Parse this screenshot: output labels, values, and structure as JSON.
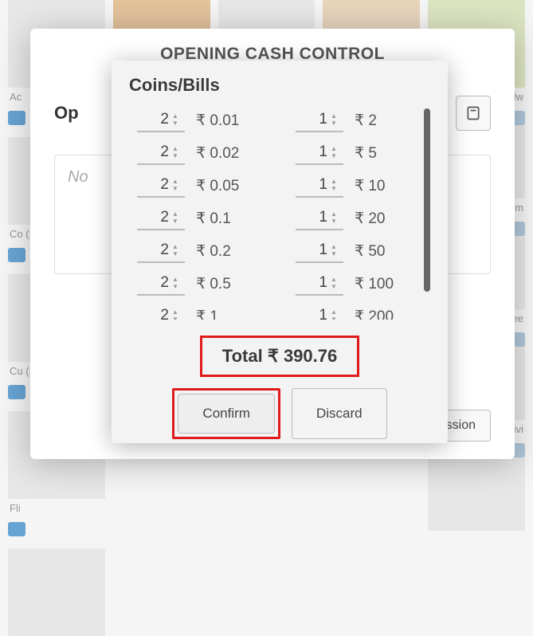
{
  "background": {
    "labels": [
      "Ac",
      "Co (St",
      "Cu (St",
      "Fli"
    ],
    "right_labels": [
      "hicke ndw",
      "usto lum",
      "esk ree",
      "divi"
    ],
    "open_session": "Open session",
    "notes_placeholder": "No",
    "opening_label": "Op",
    "modal_title": "OPENING CASH CONTROL"
  },
  "coins_bills": {
    "title": "Coins/Bills",
    "currency": "₹",
    "left": [
      {
        "qty": 2,
        "val": "0.01"
      },
      {
        "qty": 2,
        "val": "0.02"
      },
      {
        "qty": 2,
        "val": "0.05"
      },
      {
        "qty": 2,
        "val": "0.1"
      },
      {
        "qty": 2,
        "val": "0.2"
      },
      {
        "qty": 2,
        "val": "0.5"
      },
      {
        "qty": 2,
        "val": "1"
      }
    ],
    "right": [
      {
        "qty": 1,
        "val": "2"
      },
      {
        "qty": 1,
        "val": "5"
      },
      {
        "qty": 1,
        "val": "10"
      },
      {
        "qty": 1,
        "val": "20"
      },
      {
        "qty": 1,
        "val": "50"
      },
      {
        "qty": 1,
        "val": "100"
      },
      {
        "qty": 1,
        "val": "200"
      }
    ],
    "total_label": "Total",
    "total_value": "390.76",
    "confirm": "Confirm",
    "discard": "Discard"
  }
}
